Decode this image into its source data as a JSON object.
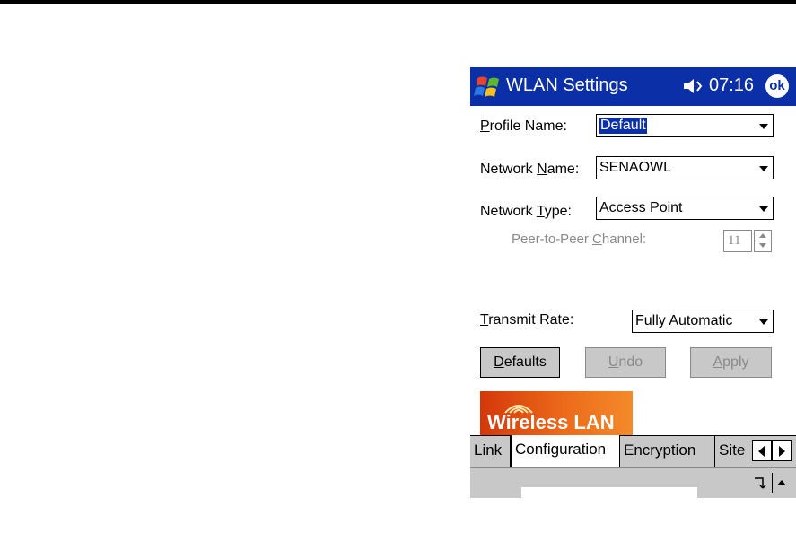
{
  "titlebar": {
    "title": "WLAN Settings",
    "clock": "07:16",
    "ok_label": "ok"
  },
  "form": {
    "profile_name": {
      "label_pre": "",
      "label_accel": "P",
      "label_post": "rofile Name:",
      "value": "Default"
    },
    "network_name": {
      "label_pre": "Network ",
      "label_accel": "N",
      "label_post": "ame:",
      "value": "SENAOWL"
    },
    "network_type": {
      "label_pre": "Network ",
      "label_accel": "T",
      "label_post": "ype:",
      "value": "Access Point"
    },
    "peer_channel": {
      "label_pre": "Peer-to-Peer ",
      "label_accel": "C",
      "label_post": "hannel:",
      "value": "11"
    },
    "transmit_rate": {
      "label_pre": "",
      "label_accel": "T",
      "label_post": "ransmit Rate:",
      "value": "Fully Automatic"
    }
  },
  "buttons": {
    "defaults": {
      "accel": "D",
      "rest": "efaults"
    },
    "undo": {
      "accel": "U",
      "rest": "ndo"
    },
    "apply": {
      "accel": "A",
      "rest": "pply"
    }
  },
  "banner": {
    "text": "Wireless LAN"
  },
  "tabs": [
    "Link",
    "Configuration",
    "Encryption",
    "Site"
  ],
  "active_tab": "Configuration",
  "colors": {
    "title_bar": "#0a2fa6",
    "banner_orange": "#ec6a1a",
    "chrome_gray": "#c8c8c8"
  }
}
